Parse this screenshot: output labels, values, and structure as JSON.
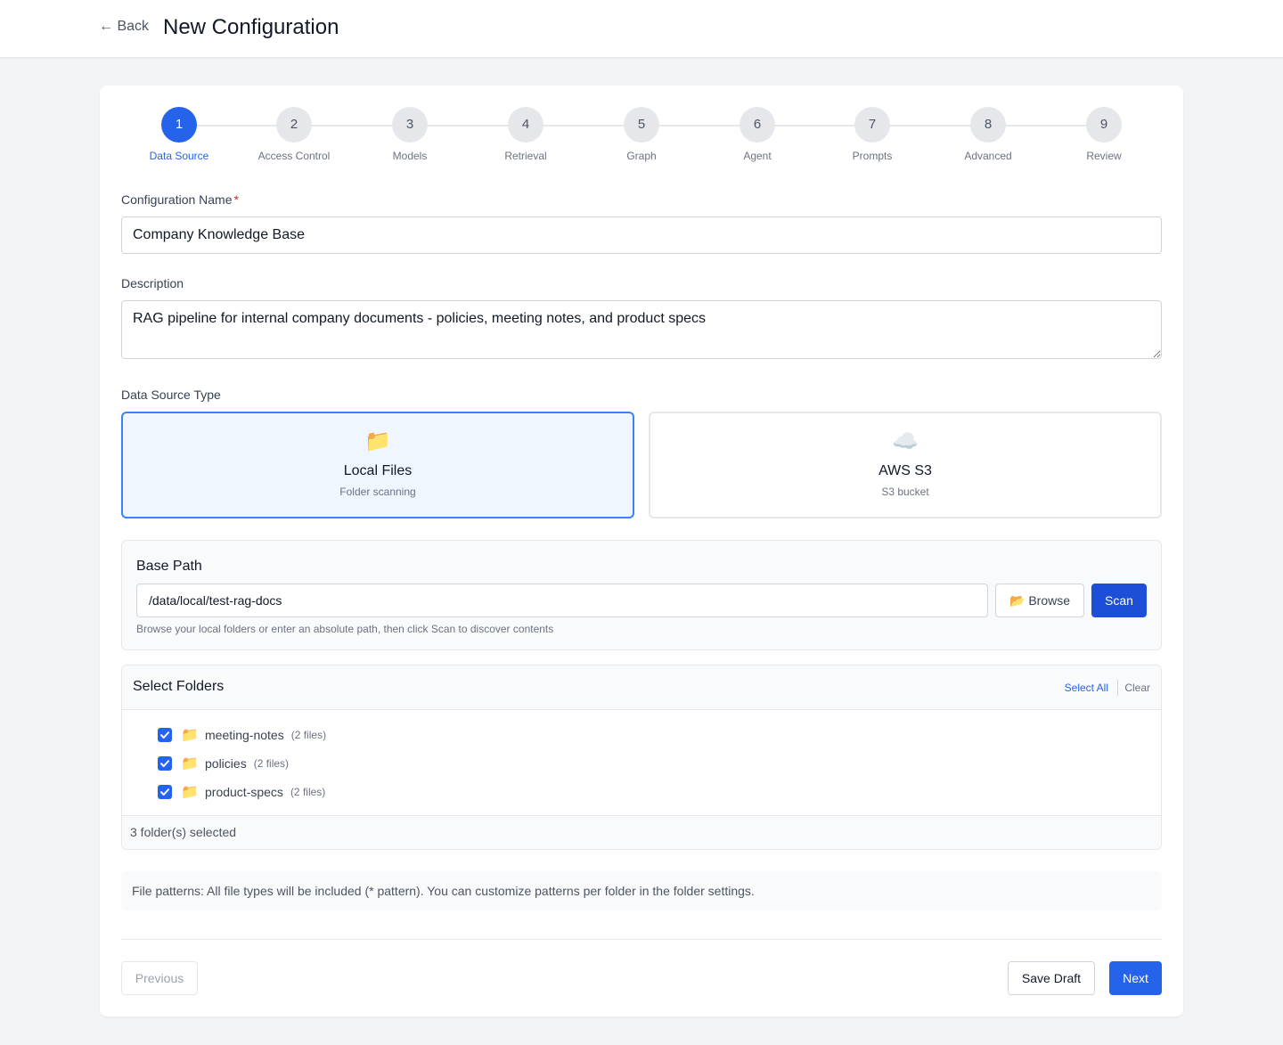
{
  "header": {
    "back_label": "← Back",
    "title": "New Configuration"
  },
  "steps": [
    {
      "number": "1",
      "label": "Data Source",
      "active": true
    },
    {
      "number": "2",
      "label": "Access Control",
      "active": false
    },
    {
      "number": "3",
      "label": "Models",
      "active": false
    },
    {
      "number": "4",
      "label": "Retrieval",
      "active": false
    },
    {
      "number": "5",
      "label": "Graph",
      "active": false
    },
    {
      "number": "6",
      "label": "Agent",
      "active": false
    },
    {
      "number": "7",
      "label": "Prompts",
      "active": false
    },
    {
      "number": "8",
      "label": "Advanced",
      "active": false
    },
    {
      "number": "9",
      "label": "Review",
      "active": false
    }
  ],
  "form": {
    "name_label": "Configuration Name",
    "required_mark": "*",
    "name_value": "Company Knowledge Base",
    "description_label": "Description",
    "description_value": "RAG pipeline for internal company documents - policies, meeting notes, and product specs",
    "source_type_label": "Data Source Type"
  },
  "sources": [
    {
      "icon": "📁",
      "icon_name": "folder-icon",
      "title": "Local Files",
      "subtitle": "Folder scanning",
      "selected": true
    },
    {
      "icon": "☁️",
      "icon_name": "cloud-icon",
      "title": "AWS S3",
      "subtitle": "S3 bucket",
      "selected": false
    }
  ],
  "base_path": {
    "title": "Base Path",
    "value": "/data/local/test-rag-docs",
    "browse_icon": "📂",
    "browse_label": "Browse",
    "scan_label": "Scan",
    "help": "Browse your local folders or enter an absolute path, then click Scan to discover contents"
  },
  "folders": {
    "title": "Select Folders",
    "select_all_label": "Select All",
    "clear_label": "Clear",
    "items": [
      {
        "icon": "📁",
        "name": "meeting-notes",
        "count": "(2 files)",
        "checked": true
      },
      {
        "icon": "📁",
        "name": "policies",
        "count": "(2 files)",
        "checked": true
      },
      {
        "icon": "📁",
        "name": "product-specs",
        "count": "(2 files)",
        "checked": true
      }
    ],
    "selected_summary": "3 folder(s) selected"
  },
  "patterns_note": "File patterns: All file types will be included (* pattern). You can customize patterns per folder in the folder settings.",
  "footer": {
    "previous_label": "Previous",
    "save_draft_label": "Save Draft",
    "next_label": "Next"
  },
  "colors": {
    "accent": "#2563eb",
    "scan_button": "#1d4ed8",
    "selected_card_bg": "#eff6ff",
    "selected_card_border": "#3b82f6",
    "required": "#dc2626"
  }
}
